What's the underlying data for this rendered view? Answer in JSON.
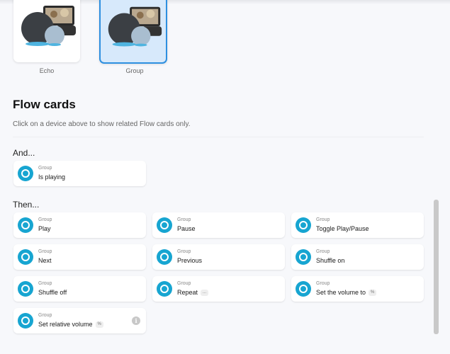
{
  "devices": [
    {
      "label": "Echo",
      "selected": false
    },
    {
      "label": "Group",
      "selected": true
    }
  ],
  "flow": {
    "title": "Flow cards",
    "subtitle": "Click on a device above to show related Flow cards only.",
    "and_label": "And...",
    "then_label": "Then...",
    "device_name": "Group",
    "and_cards": [
      {
        "name": "Is playing"
      }
    ],
    "then_cards": [
      {
        "name": "Play"
      },
      {
        "name": "Pause"
      },
      {
        "name": "Toggle Play/Pause"
      },
      {
        "name": "Next"
      },
      {
        "name": "Previous"
      },
      {
        "name": "Shuffle on"
      },
      {
        "name": "Shuffle off"
      },
      {
        "name": "Repeat",
        "arg": "..."
      },
      {
        "name": "Set the volume to",
        "arg": "%"
      },
      {
        "name": "Set relative volume",
        "arg": "%",
        "info_icon": "info-icon"
      }
    ]
  },
  "colors": {
    "accent": "#2d8fe0",
    "card_icon": "#17a5d1"
  }
}
